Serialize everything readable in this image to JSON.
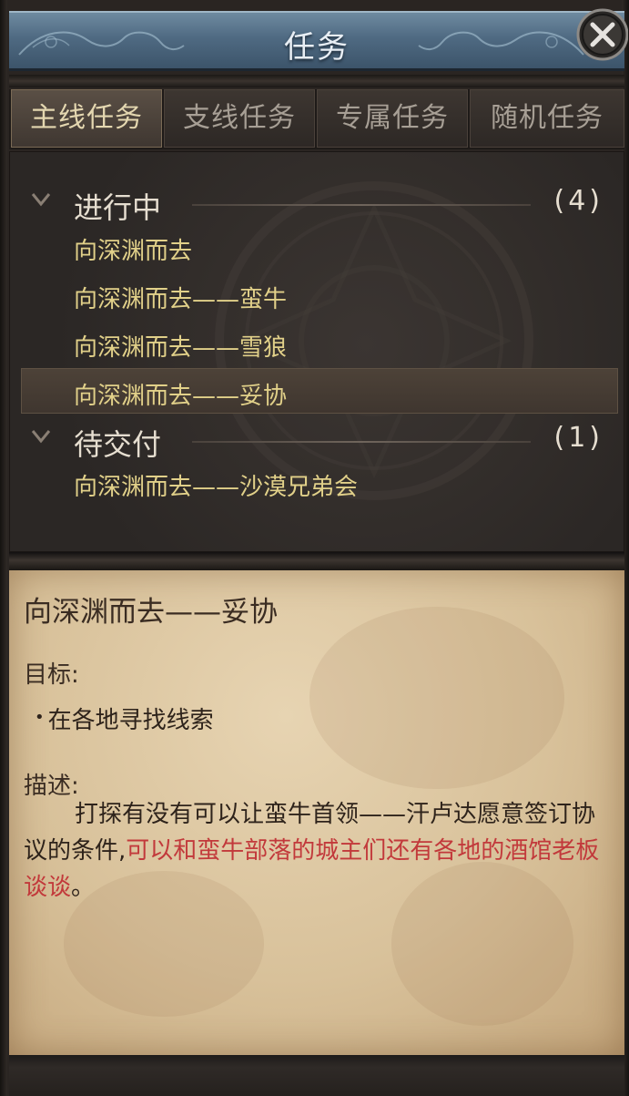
{
  "window": {
    "title": "任务",
    "close_icon": "close-icon"
  },
  "tabs": [
    {
      "label": "主线任务",
      "active": true
    },
    {
      "label": "支线任务",
      "active": false
    },
    {
      "label": "专属任务",
      "active": false
    },
    {
      "label": "随机任务",
      "active": false
    }
  ],
  "groups": [
    {
      "title": "进行中",
      "count": "(4)",
      "quests": [
        "向深渊而去",
        "向深渊而去——蛮牛",
        "向深渊而去——雪狼",
        "向深渊而去——妥协"
      ]
    },
    {
      "title": "待交付",
      "count": "(1)",
      "quests": [
        "向深渊而去——沙漠兄弟会"
      ]
    }
  ],
  "selected_quest": "向深渊而去——妥协",
  "detail": {
    "title": "向深渊而去——妥协",
    "objective_label": "目标:",
    "objective_bullet": "•",
    "objective": "在各地寻找线索",
    "description_label": "描述:",
    "description_normal": "打探有没有可以让蛮牛首领——汗卢达愿意签订协议的条件,",
    "description_highlight": "可以和蛮牛部落的城主们还有各地的酒馆老板谈谈",
    "description_end": "。"
  },
  "colors": {
    "quest_text": "#e1d089",
    "highlight_text": "#c2393b",
    "parchment": "#d8c19a",
    "title_bar": "#4f6a82"
  }
}
